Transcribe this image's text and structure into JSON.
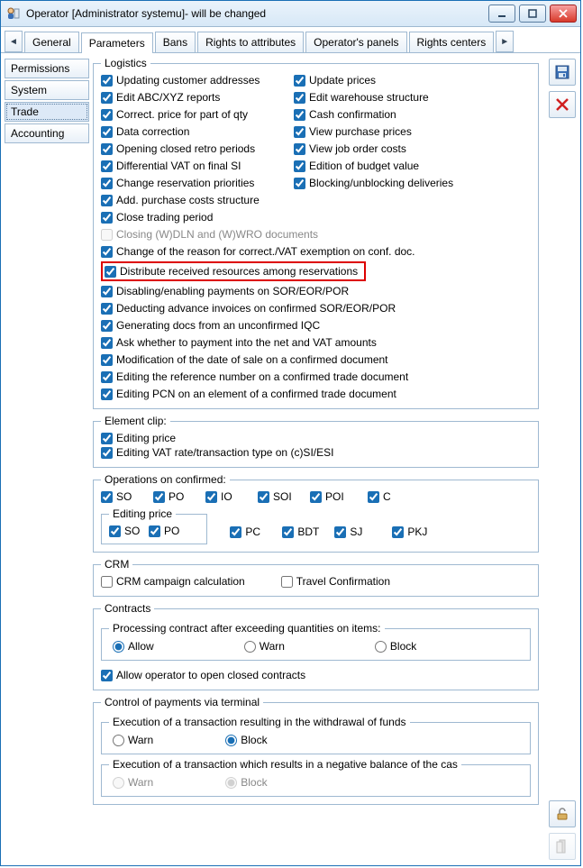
{
  "window": {
    "title": "Operator [Administrator systemu]- will be changed"
  },
  "tabs": {
    "items": [
      "General",
      "Parameters",
      "Bans",
      "Rights to attributes",
      "Operator's panels",
      "Rights centers"
    ],
    "active": 1
  },
  "side_tabs": {
    "items": [
      "Permissions",
      "System",
      "Trade",
      "Accounting"
    ],
    "active": 2
  },
  "logistics": {
    "legend": "Logistics",
    "pairs": [
      {
        "l": {
          "label": "Updating customer addresses",
          "checked": true
        },
        "r": {
          "label": "Update prices",
          "checked": true
        }
      },
      {
        "l": {
          "label": "Edit ABC/XYZ reports",
          "checked": true
        },
        "r": {
          "label": "Edit warehouse structure",
          "checked": true
        }
      },
      {
        "l": {
          "label": "Correct. price for part of qty",
          "checked": true
        },
        "r": {
          "label": "Cash confirmation",
          "checked": true
        }
      },
      {
        "l": {
          "label": "Data correction",
          "checked": true
        },
        "r": {
          "label": "View purchase prices",
          "checked": true
        }
      },
      {
        "l": {
          "label": "Opening closed retro periods",
          "checked": true
        },
        "r": {
          "label": "View job order costs",
          "checked": true
        }
      },
      {
        "l": {
          "label": "Differential VAT on final SI",
          "checked": true
        },
        "r": {
          "label": "Edition of budget value",
          "checked": true
        }
      },
      {
        "l": {
          "label": "Change reservation priorities",
          "checked": true
        },
        "r": {
          "label": "Blocking/unblocking deliveries",
          "checked": true
        }
      },
      {
        "l": {
          "label": "Add. purchase costs structure",
          "checked": true
        }
      },
      {
        "l": {
          "label": "Close trading period",
          "checked": true
        }
      },
      {
        "l": {
          "label": "Closing (W)DLN and (W)WRO documents",
          "checked": false,
          "disabled": true
        }
      },
      {
        "l": {
          "label": "Change of the reason for correct./VAT exemption on conf. doc.",
          "checked": true
        }
      },
      {
        "l": {
          "label": "Distribute received resources among reservations",
          "checked": true,
          "highlight": true
        }
      },
      {
        "l": {
          "label": "Disabling/enabling payments on SOR/EOR/POR",
          "checked": true
        }
      },
      {
        "l": {
          "label": "Deducting advance invoices on confirmed SOR/EOR/POR",
          "checked": true
        }
      },
      {
        "l": {
          "label": "Generating docs from an unconfirmed IQC",
          "checked": true
        }
      },
      {
        "l": {
          "label": "Ask whether to payment into the net and VAT amounts",
          "checked": true
        }
      },
      {
        "l": {
          "label": "Modification of the date of sale on a confirmed document",
          "checked": true
        }
      },
      {
        "l": {
          "label": "Editing the reference number on a confirmed trade document",
          "checked": true
        }
      },
      {
        "l": {
          "label": "Editing PCN on an element of a confirmed trade document",
          "checked": true
        }
      }
    ]
  },
  "element_clip": {
    "legend": "Element clip:",
    "items": [
      {
        "label": "Editing price",
        "checked": true
      },
      {
        "label": "Editing VAT rate/transaction type on (c)SI/ESI",
        "checked": true
      }
    ]
  },
  "ops": {
    "legend": "Operations on confirmed:",
    "row1": [
      "SO",
      "PO",
      "IO",
      "SOI",
      "POI",
      "C"
    ],
    "editing_price_legend": "Editing price",
    "row2": [
      "SO",
      "PO",
      "PC",
      "BDT",
      "SJ",
      "PKJ"
    ]
  },
  "crm": {
    "legend": "CRM",
    "items": [
      {
        "label": "CRM campaign calculation",
        "checked": false
      },
      {
        "label": "Travel Confirmation",
        "checked": false
      }
    ]
  },
  "contracts": {
    "legend": "Contracts",
    "processing_legend": "Processing contract after exceeding quantities on items:",
    "radios": [
      "Allow",
      "Warn",
      "Block"
    ],
    "selected": 0,
    "allow_open": {
      "label": "Allow operator to open closed contracts",
      "checked": true
    }
  },
  "terminal": {
    "legend": "Control of payments via terminal",
    "g1": {
      "legend": "Execution of a transaction resulting in the withdrawal of funds",
      "radios": [
        "Warn",
        "Block"
      ],
      "selected": 1,
      "disabled": false
    },
    "g2": {
      "legend": "Execution of a transaction which results in a negative balance of the cas",
      "radios": [
        "Warn",
        "Block"
      ],
      "selected": 1,
      "disabled": true
    }
  }
}
